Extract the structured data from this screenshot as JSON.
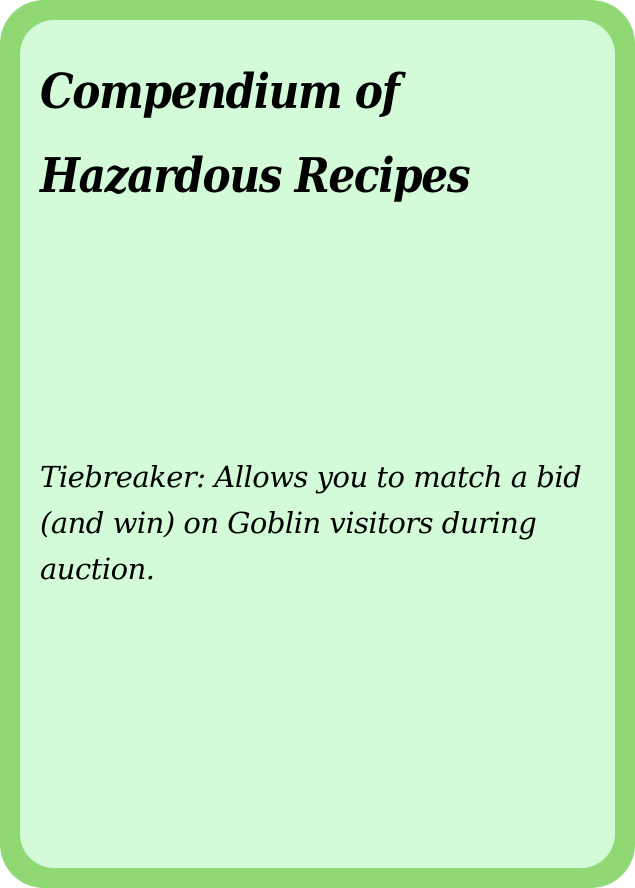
{
  "card": {
    "title": "Compendium of Hazardous Recipes",
    "ability_text": "Tiebreaker: Allows you to match a bid (and win) on Goblin visitors during auction."
  },
  "colors": {
    "border": "#8fd873",
    "background": "#d3fbd8",
    "text": "#000000"
  }
}
